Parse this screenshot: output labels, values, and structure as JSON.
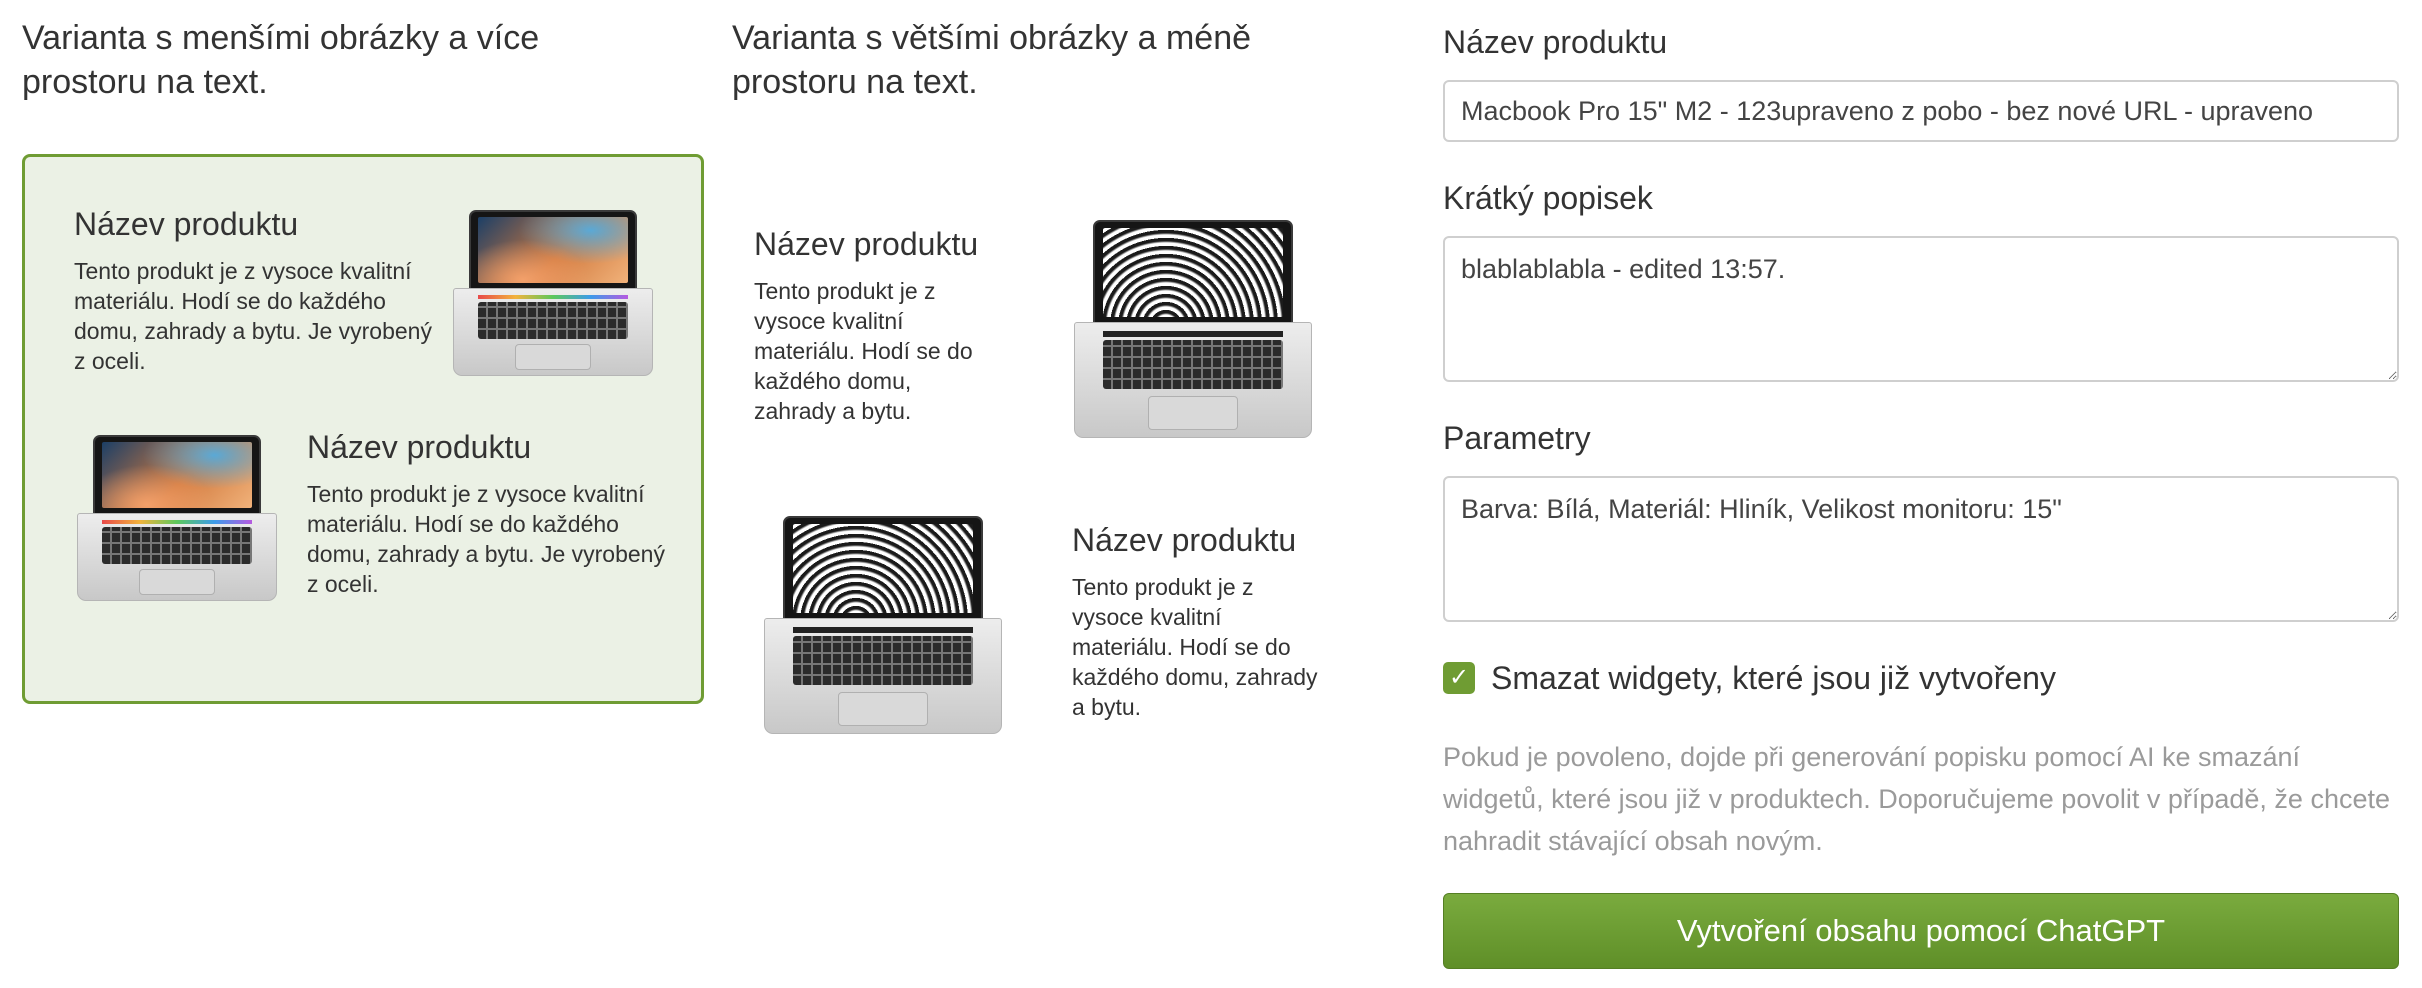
{
  "variants": [
    {
      "heading": "Varianta s menšími obrázky a více prostoru na text.",
      "selected": true,
      "items": [
        {
          "title": "Název produktu",
          "description": "Tento produkt je z vysoce kvalitní materiálu. Hodí se do každého domu, zahrady a bytu. Je vyrobený z oceli.",
          "image": "laptop-color-icon"
        },
        {
          "title": "Název produktu",
          "description": "Tento produkt je z vysoce kvalitní materiálu. Hodí se do každého domu, zahrady a bytu. Je vyrobený z oceli.",
          "image": "laptop-color-icon"
        }
      ]
    },
    {
      "heading": "Varianta s většími obrázky a méně prostoru na text.",
      "selected": false,
      "items": [
        {
          "title": "Název produktu",
          "description": "Tento produkt je z vysoce kvalitní materiálu. Hodí se do každého domu, zahrady a bytu.",
          "image": "laptop-mono-icon"
        },
        {
          "title": "Název produktu",
          "description": "Tento produkt je z vysoce kvalitní materiálu. Hodí se do každého domu, zahrady a bytu.",
          "image": "laptop-mono-icon"
        }
      ]
    }
  ],
  "form": {
    "product_name": {
      "label": "Název produktu",
      "value": "Macbook Pro 15\" M2 - 123upraveno z pobo - bez nové URL - upraveno"
    },
    "short_description": {
      "label": "Krátký popisek",
      "value": "blablablabla - edited 13:57."
    },
    "parameters": {
      "label": "Parametry",
      "value": "Barva: Bílá, Materiál: Hliník, Velikost monitoru: 15\""
    },
    "delete_widgets": {
      "label": "Smazat widgety, které jsou již vytvořeny",
      "checked": true,
      "check_glyph": "✓"
    },
    "help_text": "Pokud je povoleno, dojde při generování popisku pomocí AI ke smazání widgetů, které jsou již v produktech. Doporučujeme povolit v případě, že chcete nahradit stávající obsah novým.",
    "submit_label": "Vytvoření obsahu pomocí ChatGPT"
  },
  "colors": {
    "accent": "#6f9c33",
    "selected_bg": "#ebf1e5",
    "help_text": "#9a9a9a"
  }
}
